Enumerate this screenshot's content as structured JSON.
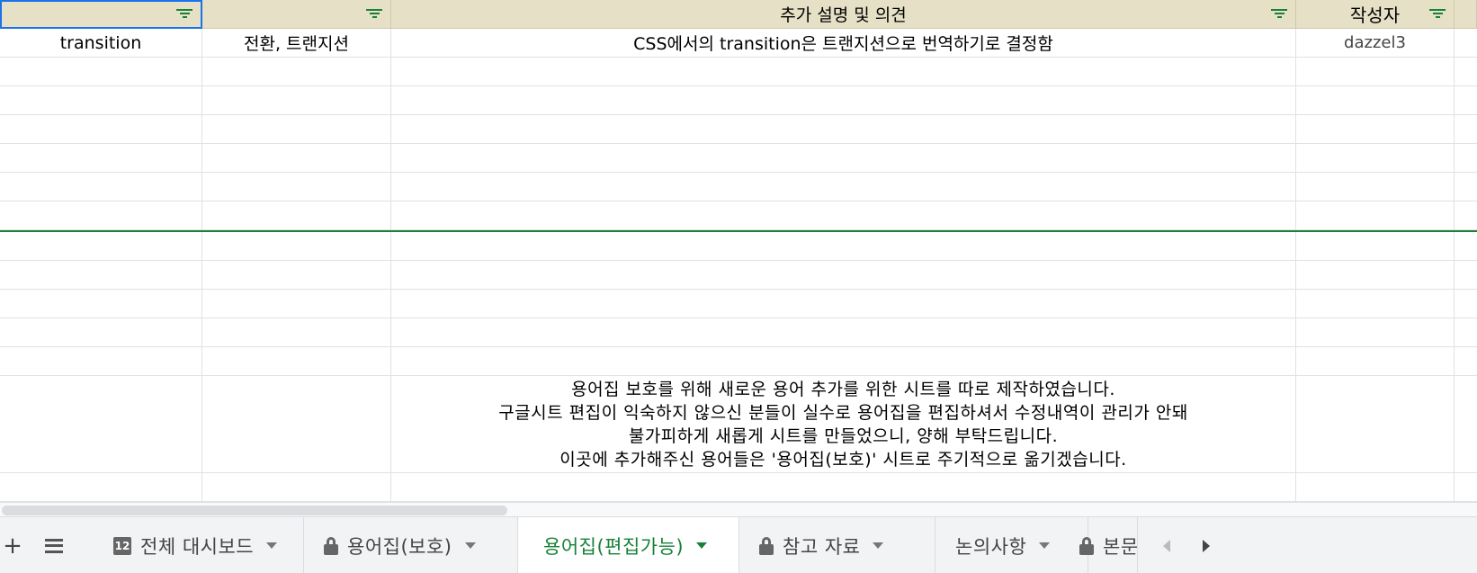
{
  "header": {
    "col1": "",
    "col2": "",
    "col3": "추가 설명 및 의견",
    "col4": "작성자"
  },
  "rows": [
    {
      "term": "transition",
      "translation": "전환, 트랜지션",
      "comment": "CSS에서의 transition은 트랜지션으로 번역하기로 결정함",
      "author": "dazzel3"
    }
  ],
  "notice": {
    "line1": "용어집 보호를 위해 새로운 용어 추가를 위한 시트를 따로 제작하였습니다.",
    "line2": "구글시트 편집이 익숙하지 않으신 분들이 실수로 용어집을 편집하셔서 수정내역이 관리가 안돼",
    "line3": "불가피하게 새롭게 시트를 만들었으니, 양해 부탁드립니다.",
    "line4": "이곳에 추가해주신 용어들은 '용어집(보호)' 시트로 주기적으로 옮기겠습니다."
  },
  "tabs": [
    {
      "label": "전체 대시보드",
      "icon": "dashboard-icon",
      "icon_text": "12"
    },
    {
      "label": "용어집(보호)",
      "icon": "lock-icon"
    },
    {
      "label": "용어집(편집가능)",
      "icon": "",
      "active": true
    },
    {
      "label": "참고 자료",
      "icon": "lock-icon"
    },
    {
      "label": "논의사항",
      "icon": ""
    },
    {
      "label": "본문",
      "icon": "lock-icon"
    }
  ],
  "toolbar": {
    "add_symbol": "+"
  },
  "colors": {
    "header_bg": "#e6e1c6",
    "accent_green": "#188038",
    "selection_blue": "#1a73e8"
  }
}
